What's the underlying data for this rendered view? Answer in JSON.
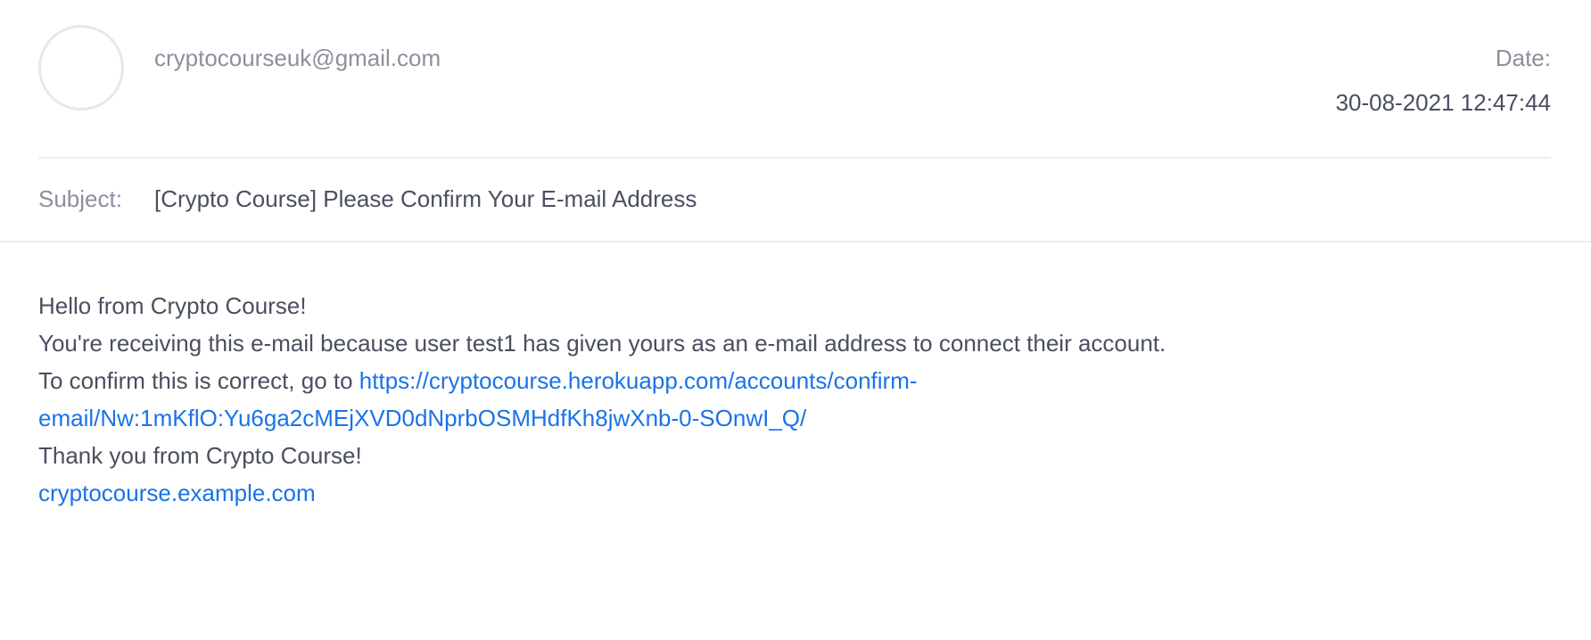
{
  "email": {
    "sender": "cryptocourseuk@gmail.com",
    "date_label": "Date:",
    "date_value": "30-08-2021 12:47:44",
    "subject_label": "Subject:",
    "subject": "[Crypto Course] Please Confirm Your E-mail Address",
    "body": {
      "greeting": "Hello from Crypto Course!",
      "reason": "You're receiving this e-mail because user test1 has given yours as an e-mail address to connect their account.",
      "confirm_prefix": "To confirm this is correct, go to ",
      "confirm_link_part1": "https://cryptocourse.herokuapp.com/accounts/confirm-",
      "confirm_link_part2": "email/Nw:1mKflO:Yu6ga2cMEjXVD0dNprbOSMHdfKh8jwXnb-0-SOnwI_Q/",
      "thanks": "Thank you from Crypto Course!",
      "site_link": "cryptocourse.example.com"
    }
  },
  "colors": {
    "link": "#1a73e8",
    "text": "#4a4f5e",
    "muted": "#8c909c"
  }
}
